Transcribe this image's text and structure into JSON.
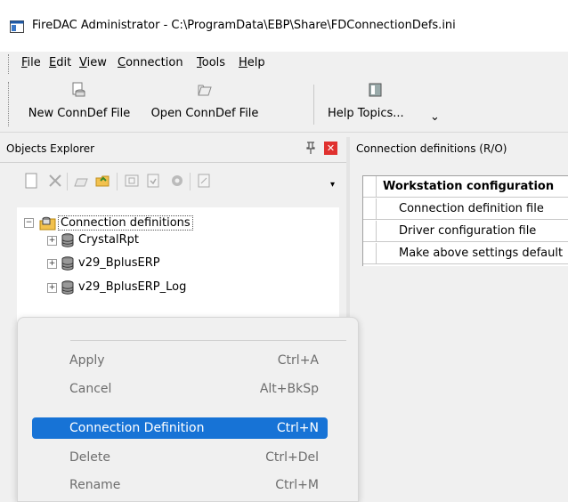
{
  "window": {
    "title": "FireDAC Administrator - C:\\ProgramData\\EBP\\Share\\FDConnectionDefs.ini"
  },
  "menu": [
    {
      "label": "File",
      "mnemonic": "F",
      "rest": "ile"
    },
    {
      "label": "Edit",
      "mnemonic": "E",
      "rest": "dit"
    },
    {
      "label": "View",
      "mnemonic": "V",
      "rest": "iew"
    },
    {
      "label": "Connection",
      "mnemonic": "C",
      "rest": "onnection"
    },
    {
      "label": "Tools",
      "mnemonic": "T",
      "rest": "ools"
    },
    {
      "label": "Help",
      "mnemonic": "H",
      "rest": "elp"
    }
  ],
  "toolbar": {
    "new_conndef": "New ConnDef File",
    "open_conndef": "Open ConnDef File",
    "help_topics": "Help Topics...",
    "help_dropdown": "⌄"
  },
  "explorer": {
    "title": "Objects Explorer",
    "pin": "📌",
    "close": "✕",
    "tools": [
      "new-icon",
      "delete-icon",
      "open-icon",
      "folder-open-icon",
      "apply-icon",
      "cancel-icon",
      "refresh-icon",
      "copy-icon"
    ],
    "tree": {
      "root": "Connection definitions",
      "root_expander": "−",
      "children": [
        {
          "label": "CrystalRpt",
          "expander": "+"
        },
        {
          "label": "v29_BplusERP",
          "expander": "+"
        },
        {
          "label": "v29_BplusERP_Log",
          "expander": "+"
        }
      ]
    }
  },
  "context_menu": {
    "items": [
      {
        "label": "Apply",
        "shortcut": "Ctrl+A",
        "enabled": false,
        "selected": false
      },
      {
        "label": "Cancel",
        "shortcut": "Alt+BkSp",
        "enabled": false,
        "selected": false
      },
      {
        "label": "Connection Definition",
        "shortcut": "Ctrl+N",
        "enabled": true,
        "selected": true
      },
      {
        "label": "Delete",
        "shortcut": "Ctrl+Del",
        "enabled": false,
        "selected": false
      },
      {
        "label": "Rename",
        "shortcut": "Ctrl+M",
        "enabled": false,
        "selected": false
      }
    ]
  },
  "right_panel": {
    "title": "Connection definitions (R/O)",
    "grid": {
      "header": "Workstation configuration",
      "rows": [
        "Connection definition file",
        "Driver configuration file",
        "Make above settings default"
      ]
    }
  },
  "colors": {
    "selection": "#1773d6",
    "close_button": "#e0312f",
    "disabled_text": "#6d6d6d"
  }
}
